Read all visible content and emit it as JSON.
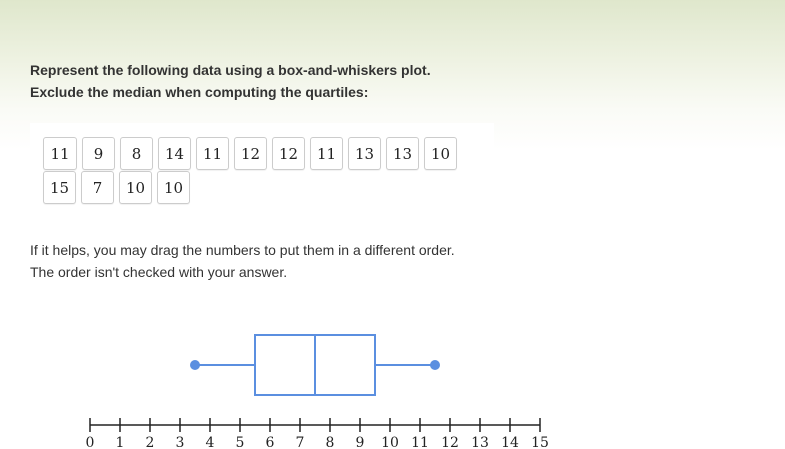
{
  "instructions": {
    "line1": "Represent the following data using a box-and-whiskers plot.",
    "line2": "Exclude the median when computing the quartiles:"
  },
  "data_tiles": [
    "11",
    "9",
    "8",
    "14",
    "11",
    "12",
    "12",
    "11",
    "13",
    "13",
    "10",
    "15",
    "7",
    "10",
    "10"
  ],
  "hint": {
    "line1": "If it helps, you may drag the numbers to put them in a different order.",
    "line2": "The order isn't checked with your answer."
  },
  "box_plot": {
    "whisker_min": 3.5,
    "q1": 5.5,
    "median": 7.5,
    "q3": 9.5,
    "whisker_max": 11.5
  },
  "number_line": {
    "min": 0,
    "max": 15,
    "ticks": [
      "0",
      "1",
      "2",
      "3",
      "4",
      "5",
      "6",
      "7",
      "8",
      "9",
      "10",
      "11",
      "12",
      "13",
      "14",
      "15"
    ]
  },
  "colors": {
    "plot_stroke": "#5b8fe0",
    "handle_fill": "#5b8fe0",
    "axis": "#222222"
  }
}
